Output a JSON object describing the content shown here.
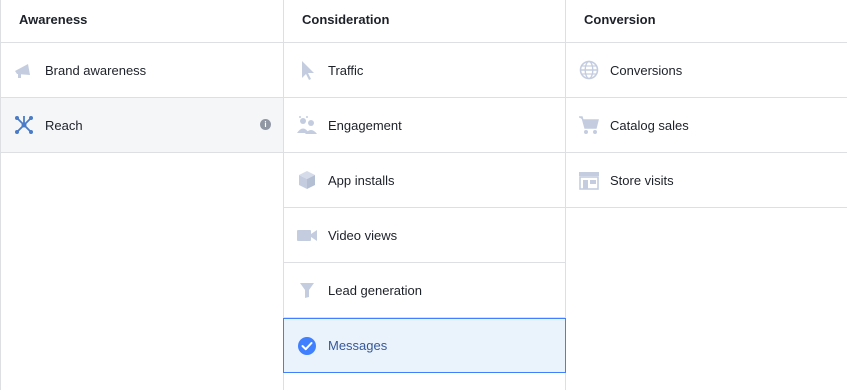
{
  "columns": [
    {
      "header": "Awareness",
      "items": [
        {
          "label": "Brand awareness",
          "icon": "megaphone-icon"
        },
        {
          "label": "Reach",
          "icon": "reach-icon",
          "info": "i"
        }
      ]
    },
    {
      "header": "Consideration",
      "items": [
        {
          "label": "Traffic",
          "icon": "cursor-icon"
        },
        {
          "label": "Engagement",
          "icon": "people-icon"
        },
        {
          "label": "App installs",
          "icon": "box-icon"
        },
        {
          "label": "Video views",
          "icon": "video-camera-icon"
        },
        {
          "label": "Lead generation",
          "icon": "funnel-icon"
        },
        {
          "label": "Messages",
          "icon": "checkmark-icon",
          "selected": true
        }
      ]
    },
    {
      "header": "Conversion",
      "items": [
        {
          "label": "Conversions",
          "icon": "globe-icon"
        },
        {
          "label": "Catalog sales",
          "icon": "shopping-cart-icon"
        },
        {
          "label": "Store visits",
          "icon": "storefront-icon"
        }
      ]
    }
  ],
  "colors": {
    "icon_gray": "#c4cde0",
    "icon_blue": "#4a7bc7",
    "selected_bg": "#eaf3fc",
    "selected_border": "#4080ff",
    "border": "#dddfe2"
  }
}
